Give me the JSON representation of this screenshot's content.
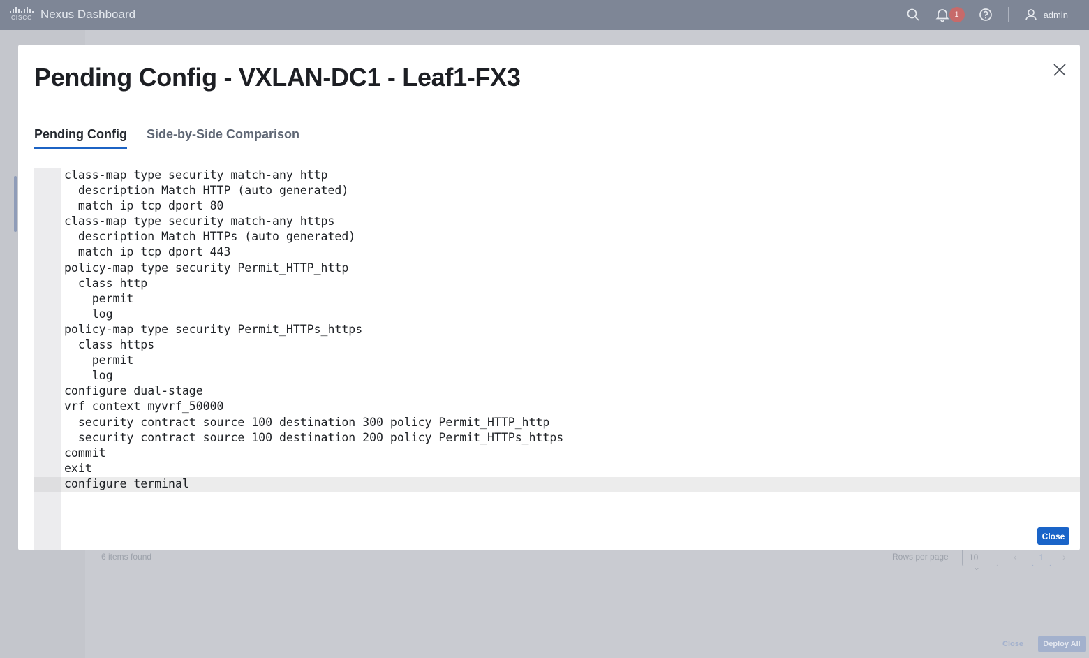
{
  "topbar": {
    "logo_text": "CISCO",
    "app_title": "Nexus Dashboard",
    "notification_count": "1",
    "user_name": "admin"
  },
  "background": {
    "items_found": "6 items found",
    "rows_per_page_label": "Rows per page",
    "rows_per_page_value": "10",
    "current_page": "1",
    "close_label": "Close",
    "deploy_all_label": "Deploy All"
  },
  "modal": {
    "title": "Pending Config - VXLAN-DC1 - Leaf1-FX3",
    "tabs": [
      {
        "label": "Pending Config",
        "active": true
      },
      {
        "label": "Side-by-Side Comparison",
        "active": false
      }
    ],
    "config_lines": [
      "class-map type security match-any http",
      "  description Match HTTP (auto generated)",
      "  match ip tcp dport 80",
      "class-map type security match-any https",
      "  description Match HTTPs (auto generated)",
      "  match ip tcp dport 443",
      "policy-map type security Permit_HTTP_http",
      "  class http",
      "    permit",
      "    log",
      "policy-map type security Permit_HTTPs_https",
      "  class https",
      "    permit",
      "    log",
      "configure dual-stage",
      "vrf context myvrf_50000",
      "  security contract source 100 destination 300 policy Permit_HTTP_http",
      "  security contract source 100 destination 200 policy Permit_HTTPs_https",
      "commit",
      "exit",
      "configure terminal"
    ],
    "close_button_label": "Close"
  },
  "colors": {
    "topbar": "#7e8696",
    "accent": "#1a64c8",
    "overlay": "#c9cbd1"
  }
}
